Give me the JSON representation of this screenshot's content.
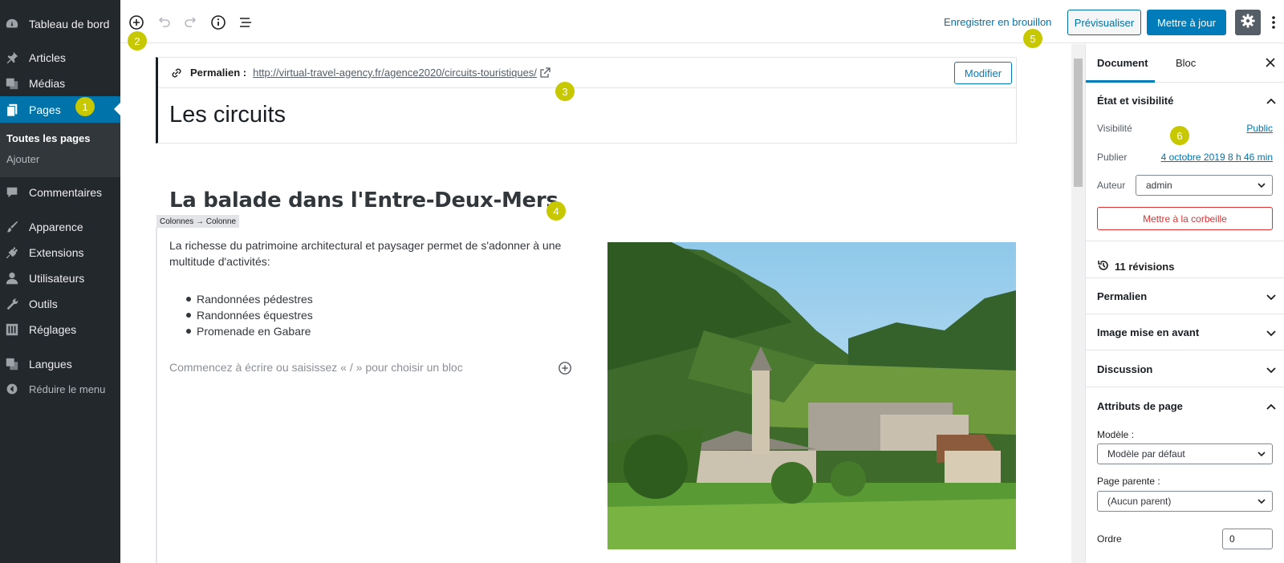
{
  "admin_menu": {
    "items": [
      {
        "label": "Tableau de bord",
        "icon": "dashboard-icon"
      },
      {
        "label": "Articles",
        "icon": "pin-icon"
      },
      {
        "label": "Médias",
        "icon": "media-icon"
      },
      {
        "label": "Pages",
        "icon": "pages-icon"
      },
      {
        "label": "Commentaires",
        "icon": "comments-icon"
      },
      {
        "label": "Apparence",
        "icon": "brush-icon"
      },
      {
        "label": "Extensions",
        "icon": "plugin-icon"
      },
      {
        "label": "Utilisateurs",
        "icon": "user-icon"
      },
      {
        "label": "Outils",
        "icon": "wrench-icon"
      },
      {
        "label": "Réglages",
        "icon": "settings-sliders-icon"
      },
      {
        "label": "Langues",
        "icon": "translate-icon"
      }
    ],
    "submenu": [
      "Toutes les pages",
      "Ajouter"
    ],
    "collapse_label": "Réduire le menu"
  },
  "toolbar": {
    "save_draft": "Enregistrer en brouillon",
    "preview": "Prévisualiser",
    "update": "Mettre à jour"
  },
  "editor": {
    "permalink_label": "Permalien :",
    "permalink_url": "http://virtual-travel-agency.fr/agence2020/circuits-touristiques/",
    "modify_button": "Modifier",
    "post_title": "Les circuits",
    "heading": "La balade dans l'Entre-Deux-Mers",
    "breadcrumb": "Colonnes → Colonne",
    "paragraph": "La richesse du patrimoine architectural et paysager permet de s'adonner à une multitude d'activités:",
    "list_items": [
      "Randonnées pédestres",
      "Randonnées équestres",
      "Promenade en Gabare"
    ],
    "placeholder": "Commencez à écrire ou saisissez « / » pour choisir un bloc"
  },
  "panel": {
    "tabs": [
      "Document",
      "Bloc"
    ],
    "status_title": "État et visibilité",
    "visibility_label": "Visibilité",
    "visibility_value": "Public",
    "publish_label": "Publier",
    "publish_value": "4 octobre 2019 8 h 46 min",
    "author_label": "Auteur",
    "author_value": "admin",
    "trash_button": "Mettre à la corbeille",
    "revisions": "11 révisions",
    "sections": [
      "Permalien",
      "Image mise en avant",
      "Discussion"
    ],
    "page_attributes": "Attributs de page",
    "template_label": "Modèle :",
    "template_value": "Modèle par défaut",
    "parent_label": "Page parente :",
    "parent_value": "(Aucun parent)",
    "order_label": "Ordre",
    "order_value": "0"
  },
  "markers": [
    "1",
    "2",
    "3",
    "4",
    "5",
    "6"
  ],
  "colors": {
    "admin_bg": "#23282d",
    "accent": "#0073aa",
    "marker": "#c8c800",
    "danger": "#dc3232"
  }
}
